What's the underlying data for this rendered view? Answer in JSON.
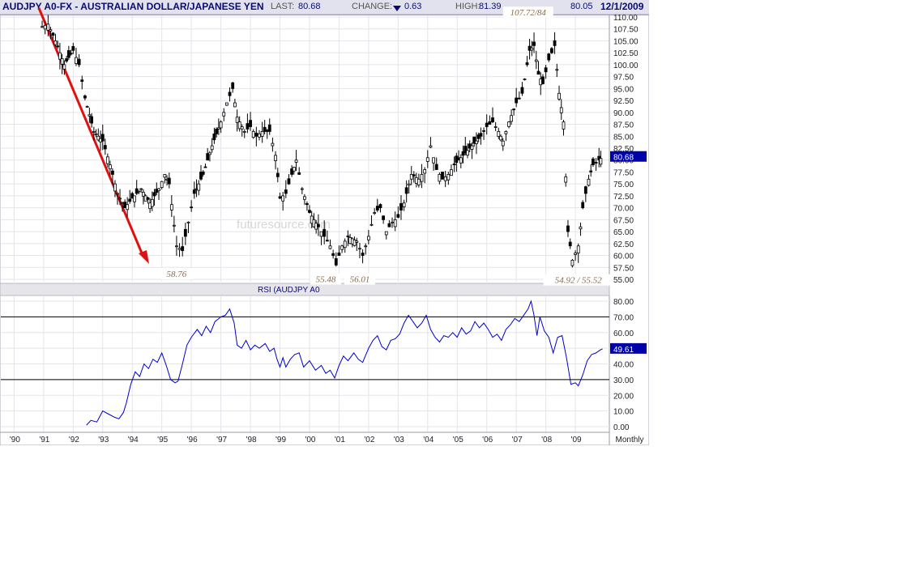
{
  "header": {
    "title": "AUDJPY A0-FX - AUSTRALIAN DOLLAR/JAPANESE YEN",
    "last_label": "LAST:",
    "last_value": "80.68",
    "change_label": "CHANGE:",
    "change_value": "0.63",
    "high_label": "HIGH:",
    "high_value": "81.39",
    "low_value": "80.05",
    "date": "12/1/2009"
  },
  "watermark": "futuresource.com",
  "colors": {
    "candles": "#000000",
    "rsi_line": "#0000cc",
    "arrow": "#e01010",
    "value_box": "#0000aa",
    "annotation": "#8a6a4a"
  },
  "chart_data": [
    {
      "type": "candlestick",
      "title": "AUDJPY A0-FX - AUSTRALIAN DOLLAR/JAPANESE YEN",
      "ylim": [
        55,
        110
      ],
      "y_ticks": [
        "110.00",
        "107.50",
        "105.00",
        "102.50",
        "100.00",
        "97.50",
        "95.00",
        "92.50",
        "90.00",
        "87.50",
        "85.00",
        "82.50",
        "80.00",
        "77.50",
        "75.00",
        "72.50",
        "70.00",
        "67.50",
        "65.00",
        "62.50",
        "60.00",
        "57.50",
        "55.00"
      ],
      "last_value_label": "80.68",
      "series": [
        {
          "values": [
            [
              1990.95,
              108
            ],
            [
              1991.15,
              108.5
            ],
            [
              1991.4,
              105
            ],
            [
              1991.7,
              100
            ],
            [
              1992.0,
              103
            ],
            [
              1992.2,
              100
            ],
            [
              1992.4,
              93
            ],
            [
              1992.7,
              86
            ],
            [
              1993.0,
              84
            ],
            [
              1993.25,
              79
            ],
            [
              1993.5,
              73
            ],
            [
              1993.75,
              70
            ],
            [
              1994.0,
              72
            ],
            [
              1994.3,
              74
            ],
            [
              1994.6,
              71
            ],
            [
              1994.9,
              74
            ],
            [
              1995.1,
              77
            ],
            [
              1995.25,
              75
            ],
            [
              1995.5,
              62
            ],
            [
              1995.7,
              61
            ],
            [
              1995.9,
              67
            ],
            [
              1996.1,
              73
            ],
            [
              1996.4,
              77
            ],
            [
              1996.7,
              83
            ],
            [
              1997.0,
              88
            ],
            [
              1997.2,
              92
            ],
            [
              1997.4,
              95
            ],
            [
              1997.55,
              89
            ],
            [
              1997.8,
              86
            ],
            [
              1998.0,
              87
            ],
            [
              1998.2,
              85
            ],
            [
              1998.4,
              86
            ],
            [
              1998.65,
              86
            ],
            [
              1998.85,
              81
            ],
            [
              1999.0,
              72
            ],
            [
              1999.2,
              73
            ],
            [
              1999.4,
              77
            ],
            [
              1999.55,
              80
            ],
            [
              1999.75,
              74
            ],
            [
              2000.0,
              69
            ],
            [
              2000.3,
              66
            ],
            [
              2000.5,
              64
            ],
            [
              2000.7,
              62
            ],
            [
              2000.9,
              58
            ],
            [
              2001.1,
              62
            ],
            [
              2001.3,
              64
            ],
            [
              2001.6,
              63
            ],
            [
              2001.8,
              60
            ],
            [
              2002.0,
              64
            ],
            [
              2002.2,
              69
            ],
            [
              2002.4,
              70
            ],
            [
              2002.6,
              65
            ],
            [
              2002.8,
              67
            ],
            [
              2003.0,
              68
            ],
            [
              2003.2,
              71
            ],
            [
              2003.45,
              77
            ],
            [
              2003.7,
              76
            ],
            [
              2003.9,
              78
            ],
            [
              2004.1,
              83
            ],
            [
              2004.3,
              78
            ],
            [
              2004.5,
              76
            ],
            [
              2004.7,
              77
            ],
            [
              2004.9,
              79
            ],
            [
              2005.2,
              81
            ],
            [
              2005.5,
              83
            ],
            [
              2005.8,
              85
            ],
            [
              2006.0,
              87
            ],
            [
              2006.2,
              88
            ],
            [
              2006.4,
              86
            ],
            [
              2006.55,
              84
            ],
            [
              2006.75,
              88
            ],
            [
              2007.0,
              92
            ],
            [
              2007.2,
              94
            ],
            [
              2007.45,
              103
            ],
            [
              2007.6,
              104
            ],
            [
              2007.75,
              98
            ],
            [
              2007.9,
              96
            ],
            [
              2008.1,
              101
            ],
            [
              2008.3,
              104
            ],
            [
              2008.45,
              94
            ],
            [
              2008.6,
              88
            ],
            [
              2008.75,
              65
            ],
            [
              2008.9,
              59
            ],
            [
              2009.1,
              62
            ],
            [
              2009.25,
              70
            ],
            [
              2009.45,
              76
            ],
            [
              2009.6,
              79
            ],
            [
              2009.8,
              80
            ],
            [
              2009.92,
              80.68
            ]
          ]
        }
      ],
      "annotations": [
        {
          "text": "58.76",
          "x": 1995.5,
          "y": 55.5
        },
        {
          "text": "55.48",
          "x": 2000.55,
          "y": 54.4
        },
        {
          "text": "56.01",
          "x": 2001.7,
          "y": 54.4
        },
        {
          "text": "107.72/84",
          "x": 2007.4,
          "y": 110.3
        },
        {
          "text": "54.92 / 55.52",
          "x": 2009.1,
          "y": 54.2
        }
      ]
    },
    {
      "type": "line",
      "title": "RSI (AUDJPY A0",
      "ylim": [
        0,
        80
      ],
      "y_ticks": [
        "80.00",
        "70.00",
        "60.00",
        "50.00",
        "40.00",
        "30.00",
        "20.00",
        "10.00",
        "0.00"
      ],
      "reference_lines": [
        70,
        30
      ],
      "last_value_label": "49.61",
      "x_ticks": [
        "'90",
        "'91",
        "'92",
        "'93",
        "'94",
        "'95",
        "'96",
        "'97",
        "'98",
        "'99",
        "'00",
        "'01",
        "'02",
        "'03",
        "'04",
        "'05",
        "'06",
        "'07",
        "'08",
        "'09"
      ],
      "x_ticks_values": [
        1990,
        1991,
        1992,
        1993,
        1994,
        1995,
        1996,
        1997,
        1998,
        1999,
        2000,
        2001,
        2002,
        2003,
        2004,
        2005,
        2006,
        2007,
        2008,
        2009
      ],
      "xlim": [
        1989.55,
        2010.15
      ],
      "period_label": "Monthly",
      "series": [
        {
          "values": [
            [
              1992.45,
              1
            ],
            [
              1992.6,
              4
            ],
            [
              1992.8,
              3
            ],
            [
              1993.0,
              10
            ],
            [
              1993.2,
              8
            ],
            [
              1993.4,
              6
            ],
            [
              1993.55,
              5
            ],
            [
              1993.7,
              9
            ],
            [
              1993.8,
              15
            ],
            [
              1993.95,
              27
            ],
            [
              1994.1,
              35
            ],
            [
              1994.25,
              32
            ],
            [
              1994.4,
              40
            ],
            [
              1994.55,
              37
            ],
            [
              1994.7,
              43
            ],
            [
              1994.85,
              41
            ],
            [
              1995.0,
              47
            ],
            [
              1995.15,
              39
            ],
            [
              1995.3,
              30
            ],
            [
              1995.45,
              28
            ],
            [
              1995.55,
              29
            ],
            [
              1995.7,
              40
            ],
            [
              1995.85,
              52
            ],
            [
              1996.0,
              57
            ],
            [
              1996.2,
              62
            ],
            [
              1996.35,
              58
            ],
            [
              1996.5,
              64
            ],
            [
              1996.65,
              60
            ],
            [
              1996.8,
              67
            ],
            [
              1997.0,
              70
            ],
            [
              1997.15,
              71
            ],
            [
              1997.3,
              75
            ],
            [
              1997.45,
              66
            ],
            [
              1997.55,
              52
            ],
            [
              1997.7,
              50
            ],
            [
              1997.85,
              55
            ],
            [
              1998.0,
              49
            ],
            [
              1998.15,
              52
            ],
            [
              1998.3,
              50
            ],
            [
              1998.5,
              53
            ],
            [
              1998.65,
              48
            ],
            [
              1998.8,
              50
            ],
            [
              1998.9,
              43
            ],
            [
              1999.0,
              38
            ],
            [
              1999.1,
              44
            ],
            [
              1999.2,
              38
            ],
            [
              1999.35,
              43
            ],
            [
              1999.5,
              46
            ],
            [
              1999.65,
              47
            ],
            [
              1999.8,
              38
            ],
            [
              2000.0,
              42
            ],
            [
              2000.2,
              36
            ],
            [
              2000.4,
              39
            ],
            [
              2000.55,
              34
            ],
            [
              2000.7,
              36
            ],
            [
              2000.85,
              31
            ],
            [
              2001.0,
              39
            ],
            [
              2001.15,
              45
            ],
            [
              2001.3,
              42
            ],
            [
              2001.5,
              47
            ],
            [
              2001.65,
              43
            ],
            [
              2001.8,
              41
            ],
            [
              2002.0,
              50
            ],
            [
              2002.15,
              55
            ],
            [
              2002.3,
              58
            ],
            [
              2002.45,
              51
            ],
            [
              2002.6,
              49
            ],
            [
              2002.75,
              55
            ],
            [
              2002.9,
              56
            ],
            [
              2003.05,
              59
            ],
            [
              2003.2,
              66
            ],
            [
              2003.35,
              71
            ],
            [
              2003.5,
              67
            ],
            [
              2003.65,
              63
            ],
            [
              2003.8,
              66
            ],
            [
              2003.95,
              71
            ],
            [
              2004.1,
              62
            ],
            [
              2004.25,
              57
            ],
            [
              2004.4,
              54
            ],
            [
              2004.55,
              58
            ],
            [
              2004.7,
              57
            ],
            [
              2004.85,
              60
            ],
            [
              2005.0,
              57
            ],
            [
              2005.15,
              63
            ],
            [
              2005.3,
              59
            ],
            [
              2005.45,
              61
            ],
            [
              2005.6,
              67
            ],
            [
              2005.75,
              63
            ],
            [
              2005.9,
              66
            ],
            [
              2006.05,
              62
            ],
            [
              2006.2,
              57
            ],
            [
              2006.35,
              59
            ],
            [
              2006.5,
              55
            ],
            [
              2006.65,
              62
            ],
            [
              2006.8,
              65
            ],
            [
              2006.95,
              69
            ],
            [
              2007.1,
              67
            ],
            [
              2007.25,
              71
            ],
            [
              2007.4,
              75
            ],
            [
              2007.5,
              80
            ],
            [
              2007.6,
              71
            ],
            [
              2007.7,
              58
            ],
            [
              2007.8,
              70
            ],
            [
              2007.95,
              61
            ],
            [
              2008.1,
              57
            ],
            [
              2008.25,
              47
            ],
            [
              2008.4,
              57
            ],
            [
              2008.55,
              58
            ],
            [
              2008.7,
              44
            ],
            [
              2008.85,
              27
            ],
            [
              2009.0,
              28
            ],
            [
              2009.1,
              26
            ],
            [
              2009.25,
              33
            ],
            [
              2009.4,
              42
            ],
            [
              2009.55,
              46
            ],
            [
              2009.7,
              47
            ],
            [
              2009.85,
              49
            ],
            [
              2009.92,
              49.61
            ]
          ]
        }
      ]
    }
  ]
}
